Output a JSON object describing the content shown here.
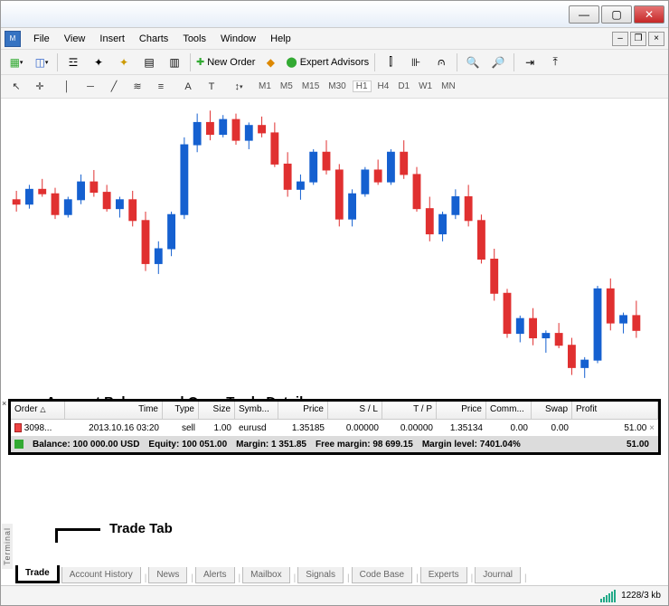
{
  "window": {
    "minimize": "—",
    "maximize": "▢",
    "close": "✕"
  },
  "menu": {
    "file": "File",
    "view": "View",
    "insert": "Insert",
    "charts": "Charts",
    "tools": "Tools",
    "window": "Window",
    "help": "Help"
  },
  "toolbar": {
    "new_order": "New Order",
    "expert_advisors": "Expert Advisors"
  },
  "timeframes": {
    "m1": "M1",
    "m5": "M5",
    "m15": "M15",
    "m30": "M30",
    "h1": "H1",
    "h4": "H4",
    "d1": "D1",
    "w1": "W1",
    "mn": "MN"
  },
  "annotations": {
    "balance": "Account Balance and Open Trade Details",
    "trade_tab": "Trade Tab"
  },
  "terminal": {
    "label": "Terminal",
    "headers": {
      "order": "Order",
      "time": "Time",
      "type": "Type",
      "size": "Size",
      "symbol": "Symb...",
      "price": "Price",
      "sl": "S / L",
      "tp": "T / P",
      "price2": "Price",
      "comm": "Comm...",
      "swap": "Swap",
      "profit": "Profit"
    },
    "row": {
      "order": "3098...",
      "time": "2013.10.16 03:20",
      "type": "sell",
      "size": "1.00",
      "symbol": "eurusd",
      "price": "1.35185",
      "sl": "0.00000",
      "tp": "0.00000",
      "price2": "1.35134",
      "comm": "0.00",
      "swap": "0.00",
      "profit": "51.00"
    },
    "balance_line": {
      "balance_lbl": "Balance:",
      "balance": "100 000.00 USD",
      "equity_lbl": "Equity:",
      "equity": "100 051.00",
      "margin_lbl": "Margin:",
      "margin": "1 351.85",
      "free_lbl": "Free margin:",
      "free": "98 699.15",
      "level_lbl": "Margin level:",
      "level": "7401.04%",
      "profit": "51.00"
    }
  },
  "tabs": {
    "trade": "Trade",
    "history": "Account History",
    "news": "News",
    "alerts": "Alerts",
    "mailbox": "Mailbox",
    "signals": "Signals",
    "codebase": "Code Base",
    "experts": "Experts",
    "journal": "Journal"
  },
  "status": {
    "net": "1228/3 kb"
  },
  "chart_data": {
    "type": "candlestick",
    "symbol": "EURUSD",
    "timeframe": "H1",
    "note": "OHLC values approximated from pixel positions; series runs left-to-right",
    "candles": [
      {
        "o": 1.3538,
        "h": 1.3544,
        "l": 1.353,
        "c": 1.3535
      },
      {
        "o": 1.3535,
        "h": 1.3548,
        "l": 1.3532,
        "c": 1.3545
      },
      {
        "o": 1.3545,
        "h": 1.3552,
        "l": 1.354,
        "c": 1.3542
      },
      {
        "o": 1.3542,
        "h": 1.3546,
        "l": 1.3525,
        "c": 1.3528
      },
      {
        "o": 1.3528,
        "h": 1.354,
        "l": 1.3526,
        "c": 1.3538
      },
      {
        "o": 1.3538,
        "h": 1.3555,
        "l": 1.3535,
        "c": 1.355
      },
      {
        "o": 1.355,
        "h": 1.3558,
        "l": 1.354,
        "c": 1.3543
      },
      {
        "o": 1.3543,
        "h": 1.3548,
        "l": 1.353,
        "c": 1.3532
      },
      {
        "o": 1.3532,
        "h": 1.354,
        "l": 1.3526,
        "c": 1.3538
      },
      {
        "o": 1.3538,
        "h": 1.3544,
        "l": 1.352,
        "c": 1.3524
      },
      {
        "o": 1.3524,
        "h": 1.353,
        "l": 1.349,
        "c": 1.3495
      },
      {
        "o": 1.3495,
        "h": 1.351,
        "l": 1.3488,
        "c": 1.3505
      },
      {
        "o": 1.3505,
        "h": 1.353,
        "l": 1.35,
        "c": 1.3528
      },
      {
        "o": 1.3528,
        "h": 1.358,
        "l": 1.3525,
        "c": 1.3575
      },
      {
        "o": 1.3575,
        "h": 1.3596,
        "l": 1.357,
        "c": 1.359
      },
      {
        "o": 1.359,
        "h": 1.3598,
        "l": 1.3578,
        "c": 1.3582
      },
      {
        "o": 1.3582,
        "h": 1.3595,
        "l": 1.358,
        "c": 1.3592
      },
      {
        "o": 1.3592,
        "h": 1.3596,
        "l": 1.3575,
        "c": 1.3578
      },
      {
        "o": 1.3578,
        "h": 1.359,
        "l": 1.3572,
        "c": 1.3588
      },
      {
        "o": 1.3588,
        "h": 1.3594,
        "l": 1.358,
        "c": 1.3583
      },
      {
        "o": 1.3583,
        "h": 1.359,
        "l": 1.356,
        "c": 1.3562
      },
      {
        "o": 1.3562,
        "h": 1.357,
        "l": 1.354,
        "c": 1.3545
      },
      {
        "o": 1.3545,
        "h": 1.3555,
        "l": 1.3538,
        "c": 1.355
      },
      {
        "o": 1.355,
        "h": 1.3572,
        "l": 1.3548,
        "c": 1.357
      },
      {
        "o": 1.357,
        "h": 1.3578,
        "l": 1.3555,
        "c": 1.3558
      },
      {
        "o": 1.3558,
        "h": 1.3562,
        "l": 1.352,
        "c": 1.3525
      },
      {
        "o": 1.3525,
        "h": 1.3545,
        "l": 1.352,
        "c": 1.3542
      },
      {
        "o": 1.3542,
        "h": 1.356,
        "l": 1.354,
        "c": 1.3558
      },
      {
        "o": 1.3558,
        "h": 1.3565,
        "l": 1.3548,
        "c": 1.355
      },
      {
        "o": 1.355,
        "h": 1.3572,
        "l": 1.3548,
        "c": 1.357
      },
      {
        "o": 1.357,
        "h": 1.3578,
        "l": 1.3552,
        "c": 1.3555
      },
      {
        "o": 1.3555,
        "h": 1.356,
        "l": 1.353,
        "c": 1.3532
      },
      {
        "o": 1.3532,
        "h": 1.354,
        "l": 1.351,
        "c": 1.3515
      },
      {
        "o": 1.3515,
        "h": 1.353,
        "l": 1.351,
        "c": 1.3528
      },
      {
        "o": 1.3528,
        "h": 1.3545,
        "l": 1.3525,
        "c": 1.354
      },
      {
        "o": 1.354,
        "h": 1.3548,
        "l": 1.352,
        "c": 1.3524
      },
      {
        "o": 1.3524,
        "h": 1.3528,
        "l": 1.3495,
        "c": 1.3498
      },
      {
        "o": 1.3498,
        "h": 1.3505,
        "l": 1.347,
        "c": 1.3475
      },
      {
        "o": 1.3475,
        "h": 1.3478,
        "l": 1.3445,
        "c": 1.3448
      },
      {
        "o": 1.3448,
        "h": 1.346,
        "l": 1.3442,
        "c": 1.3458
      },
      {
        "o": 1.3458,
        "h": 1.3465,
        "l": 1.344,
        "c": 1.3445
      },
      {
        "o": 1.3445,
        "h": 1.345,
        "l": 1.3435,
        "c": 1.3448
      },
      {
        "o": 1.3448,
        "h": 1.3455,
        "l": 1.3438,
        "c": 1.344
      },
      {
        "o": 1.344,
        "h": 1.3445,
        "l": 1.342,
        "c": 1.3425
      },
      {
        "o": 1.3425,
        "h": 1.3432,
        "l": 1.3418,
        "c": 1.343
      },
      {
        "o": 1.343,
        "h": 1.348,
        "l": 1.3428,
        "c": 1.3478
      },
      {
        "o": 1.3478,
        "h": 1.3485,
        "l": 1.345,
        "c": 1.3455
      },
      {
        "o": 1.3455,
        "h": 1.3462,
        "l": 1.3448,
        "c": 1.346
      },
      {
        "o": 1.346,
        "h": 1.347,
        "l": 1.3445,
        "c": 1.345
      }
    ],
    "y_range": [
      1.341,
      1.36
    ]
  }
}
